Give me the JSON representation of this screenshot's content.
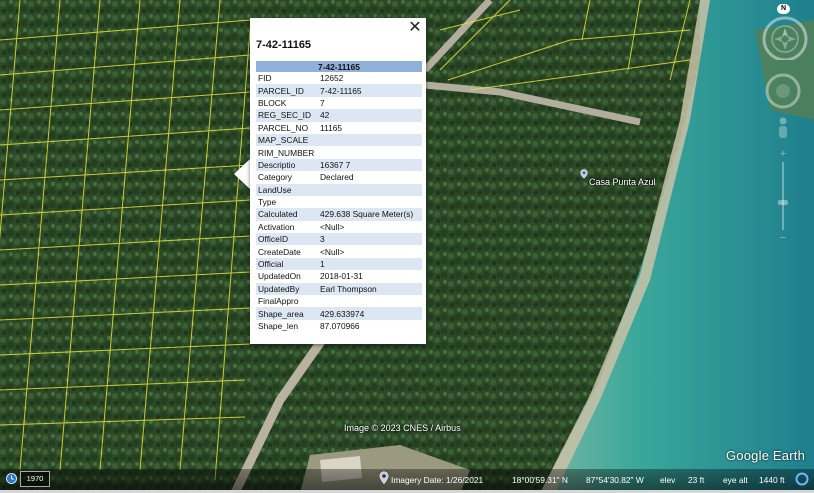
{
  "popup": {
    "title": "7-42-11165",
    "table_header": "7-42-11165",
    "close_glyph": "✕",
    "rows": [
      {
        "key": "FID",
        "value": "12652"
      },
      {
        "key": "PARCEL_ID",
        "value": "7-42-11165"
      },
      {
        "key": "BLOCK",
        "value": "7"
      },
      {
        "key": "REG_SEC_ID",
        "value": "42"
      },
      {
        "key": "PARCEL_NO",
        "value": "11165"
      },
      {
        "key": "MAP_SCALE",
        "value": ""
      },
      {
        "key": "RIM_NUMBER",
        "value": ""
      },
      {
        "key": "Descriptio",
        "value": "16367 7"
      },
      {
        "key": "Category",
        "value": "Declared"
      },
      {
        "key": "LandUse",
        "value": ""
      },
      {
        "key": "Type",
        "value": ""
      },
      {
        "key": "Calculated",
        "value": "429.638 Square Meter(s)"
      },
      {
        "key": "Activation",
        "value": "<Null>"
      },
      {
        "key": "OfficeID",
        "value": "3"
      },
      {
        "key": "CreateDate",
        "value": "<Null>"
      },
      {
        "key": "Official",
        "value": "1"
      },
      {
        "key": "UpdatedOn",
        "value": "2018-01-31"
      },
      {
        "key": "UpdatedBy",
        "value": "Earl Thompson"
      },
      {
        "key": "FinalAppro",
        "value": ""
      },
      {
        "key": "Shape_area",
        "value": "429.633974"
      },
      {
        "key": "Shape_len",
        "value": "87.070966"
      }
    ]
  },
  "map": {
    "place_label": "Casa Punta Azul",
    "attribution": "Image © 2023 CNES / Airbus",
    "brand": "Google Earth"
  },
  "nav": {
    "north_label": "N"
  },
  "statusbar": {
    "historical_year": "1970",
    "imagery_date": "Imagery Date: 1/26/2021",
    "latitude": "18°00'59.31\" N",
    "longitude": "87°54'30.82\" W",
    "elev_label": "elev",
    "elev_value": "23 ft",
    "eye_alt_label": "eye alt",
    "eye_alt_value": "1440 ft"
  },
  "colors": {
    "parcel_lines": "#e8e23a",
    "table_header_bg": "#8fb0d8",
    "table_alt_row_bg": "#dde7f3",
    "sea": "#2a9e93"
  },
  "icons": {
    "close": "close-icon",
    "compass": "compass-icon",
    "look": "look-joystick-icon",
    "pegman": "pegman-icon",
    "zoom": "zoom-slider",
    "historical": "historical-imagery-icon",
    "place": "place-marker-icon",
    "loading": "loading-ring-icon"
  }
}
